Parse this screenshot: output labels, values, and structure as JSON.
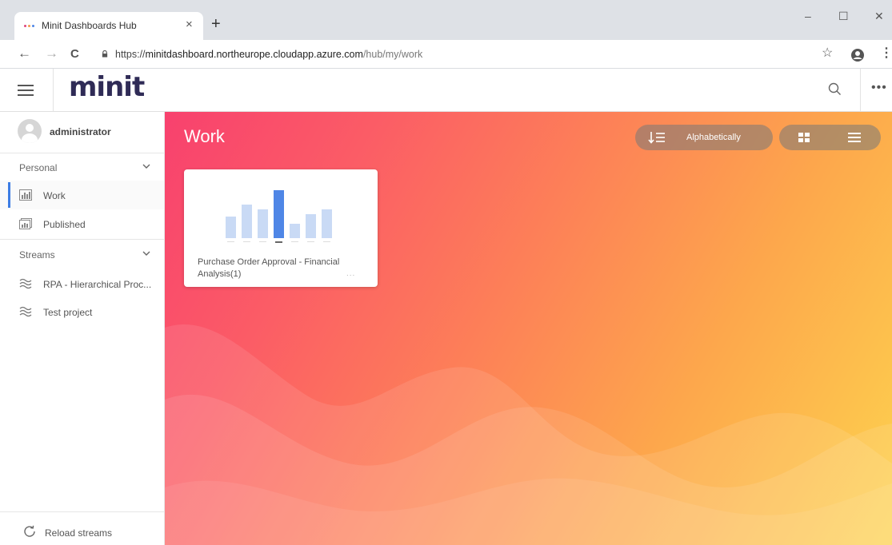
{
  "browser": {
    "tab_title": "Minit Dashboards Hub",
    "tab_close": "×",
    "new_tab": "+",
    "minimize": "–",
    "maximize": "☐",
    "close": "✕",
    "url_prefix": "https://",
    "url_host": "minitdashboard.northeurope.cloudapp.azure.com",
    "url_path": "/hub/my/work",
    "back": "←",
    "forward": "→",
    "reload": "C",
    "star": "☆",
    "menu": "⋮"
  },
  "header": {
    "logo": "minit",
    "more": "•••"
  },
  "sidebar": {
    "username": "administrator",
    "sections": [
      {
        "label": "Personal",
        "items": [
          {
            "label": "Work",
            "icon": "dashboard-icon",
            "active": true
          },
          {
            "label": "Published",
            "icon": "published-icon",
            "active": false
          }
        ]
      },
      {
        "label": "Streams",
        "items": [
          {
            "label": "RPA - Hierarchical Proc...",
            "icon": "stream-icon"
          },
          {
            "label": "Test project",
            "icon": "stream-icon"
          }
        ]
      }
    ],
    "reload_label": "Reload streams"
  },
  "main": {
    "title": "Work",
    "sort_label": "Alphabetically",
    "cards": [
      {
        "title": "Purchase Order Approval - Financial Analysis(1)",
        "more": "..."
      }
    ]
  },
  "colors": {
    "logo": "#2f2b56",
    "accent": "#3d7de4",
    "gradient_start": "#f8416e",
    "gradient_end": "#fdd34e",
    "thumb_bar_light": "#c9daf5",
    "thumb_bar_dark": "#4f86e6"
  },
  "card_thumbnail_levels": [
    0.45,
    0.7,
    0.6,
    1.0,
    0.3,
    0.5,
    0.6
  ]
}
